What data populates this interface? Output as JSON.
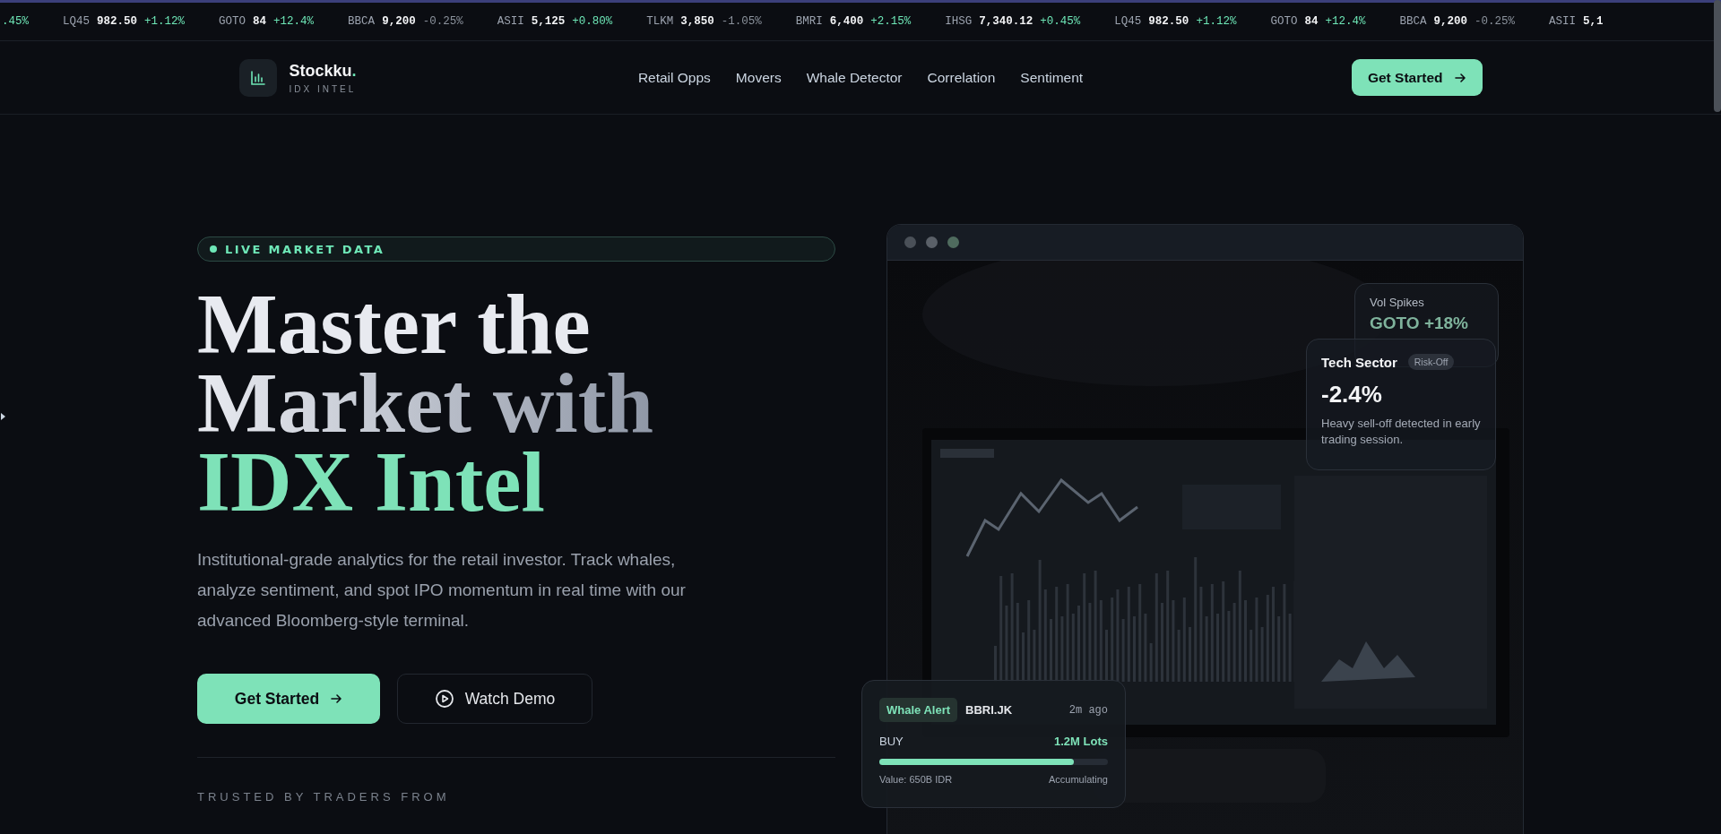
{
  "ticker": [
    {
      "change": ".45%",
      "rising": true
    },
    {
      "symbol": "LQ45",
      "price": "982.50",
      "change": "+1.12%",
      "rising": true
    },
    {
      "symbol": "GOTO",
      "price": "84",
      "change": "+12.4%",
      "rising": true
    },
    {
      "symbol": "BBCA",
      "price": "9,200",
      "change": "-0.25%",
      "rising": false
    },
    {
      "symbol": "ASII",
      "price": "5,125",
      "change": "+0.80%",
      "rising": true
    },
    {
      "symbol": "TLKM",
      "price": "3,850",
      "change": "-1.05%",
      "rising": false
    },
    {
      "symbol": "BMRI",
      "price": "6,400",
      "change": "+2.15%",
      "rising": true
    },
    {
      "symbol": "IHSG",
      "price": "7,340.12",
      "change": "+0.45%",
      "rising": true
    },
    {
      "symbol": "LQ45",
      "price": "982.50",
      "change": "+1.12%",
      "rising": true
    },
    {
      "symbol": "GOTO",
      "price": "84",
      "change": "+12.4%",
      "rising": true
    },
    {
      "symbol": "BBCA",
      "price": "9,200",
      "change": "-0.25%",
      "rising": false
    },
    {
      "symbol": "ASII",
      "price": "5,1"
    }
  ],
  "header": {
    "brand": {
      "name": "Stockku",
      "accent": ".",
      "tagline": "IDX INTEL"
    },
    "nav": [
      "Retail Opps",
      "Movers",
      "Whale Detector",
      "Correlation",
      "Sentiment"
    ],
    "cta": "Get Started"
  },
  "hero": {
    "badge": "LIVE MARKET DATA",
    "headline": [
      {
        "text": "Master the",
        "kind": "plain"
      },
      {
        "text": "Market with",
        "kind": "fade"
      },
      {
        "text": "IDX Intel",
        "kind": "accent"
      }
    ],
    "description": "Institutional-grade analytics for the retail investor. Track whales, analyze sentiment, and spot IPO momentum in real time with our advanced Bloomberg-style terminal.",
    "buttons": [
      {
        "label": "Get Started",
        "kind": "primary"
      },
      {
        "label": "Watch Demo",
        "kind": "secondary"
      }
    ],
    "trusted": "TRUSTED BY TRADERS FROM"
  },
  "preview": {
    "vol_card": {
      "label": "Vol Spikes",
      "value": "GOTO +18%"
    },
    "sector_card": {
      "title": "Tech Sector",
      "tag": "Risk-Off",
      "value": "-2.4%",
      "description": "Heavy sell-off detected in early trading session."
    },
    "whale_card": {
      "tag": "Whale Alert",
      "symbol": "BBRI.JK",
      "time": "2m ago",
      "side": "BUY",
      "amount": "1.2M Lots",
      "level": 0.85,
      "value": "Value: 650B IDR",
      "status": "Accumulating"
    }
  }
}
